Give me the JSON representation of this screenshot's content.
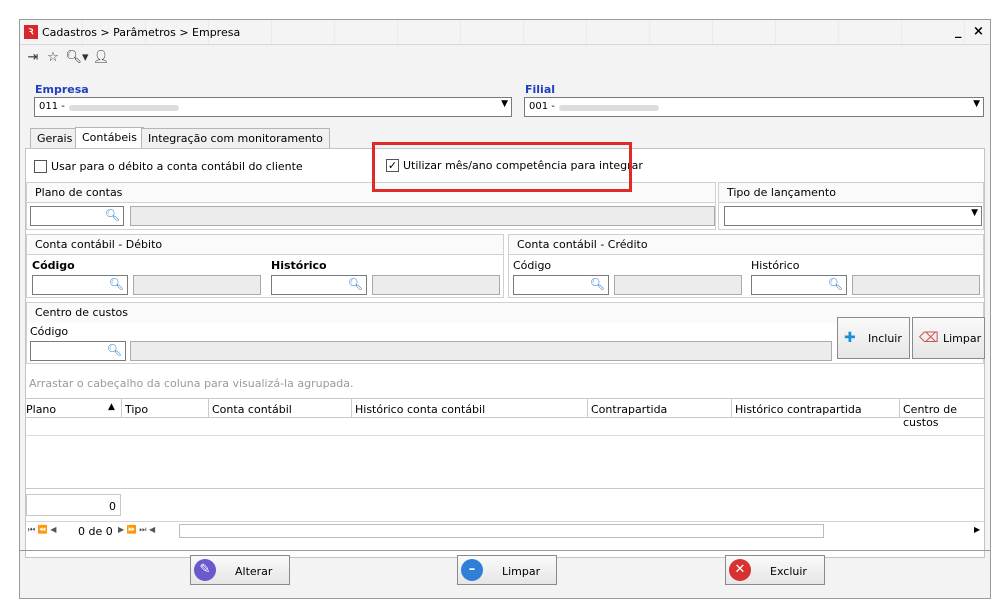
{
  "window": {
    "title": "Cadastros > Parâmetros > Empresa",
    "min": "_",
    "close": "×"
  },
  "toolbar": {
    "icons": [
      "exit-icon",
      "favorite-add-icon",
      "search-icon",
      "user-icon"
    ]
  },
  "empresa": {
    "label": "Empresa",
    "value": "011 -"
  },
  "filial": {
    "label": "Filial",
    "value": "001 -"
  },
  "tabs": [
    "Gerais",
    "Contábeis",
    "Integração com monitoramento"
  ],
  "check1": {
    "label": "Usar para o débito a conta contábil do cliente",
    "checked": false
  },
  "check2": {
    "label": "Utilizar mês/ano competência para integrar",
    "checked": true
  },
  "plano": {
    "label": "Plano de contas"
  },
  "tipo": {
    "label": "Tipo de lançamento"
  },
  "debito": {
    "label": "Conta contábil - Débito",
    "codigo": "Código",
    "historico": "Histórico"
  },
  "credito": {
    "label": "Conta contábil - Crédito",
    "codigo": "Código",
    "historico": "Histórico"
  },
  "centro": {
    "label": "Centro de custos",
    "codigo": "Código"
  },
  "buttons": {
    "incluir": "Incluir",
    "limpar": "Limpar"
  },
  "grid": {
    "group_hint": "Arrastar o cabeçalho da coluna para visualizá-la agrupada.",
    "columns": [
      "Plano",
      "Tipo",
      "Conta contábil",
      "Histórico conta contábil",
      "Contrapartida",
      "Histórico contrapartida",
      "Centro de custos"
    ],
    "count": "0",
    "nav": "0 de 0"
  },
  "footer": {
    "alterar": "Alterar",
    "limpar": "Limpar",
    "excluir": "Excluir"
  },
  "colors": {
    "accent": "#1f3fbf",
    "highlight": "#e02a2a"
  }
}
